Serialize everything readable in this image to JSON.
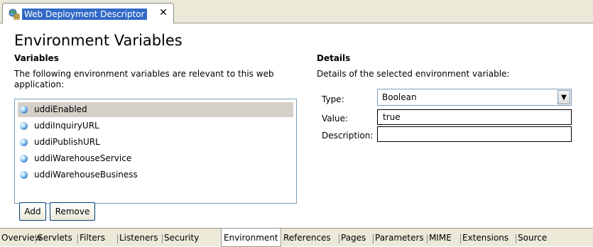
{
  "editor_tab": {
    "title": "Web Deployment Descriptor",
    "close_glyph": "✕",
    "icon": "web-app-icon"
  },
  "page": {
    "title": "Environment Variables"
  },
  "variables": {
    "title": "Variables",
    "description": "The following environment variables are relevant to this web application:",
    "items": [
      {
        "label": "uddiEnabled",
        "selected": true
      },
      {
        "label": "uddiInquiryURL",
        "selected": false
      },
      {
        "label": "uddiPublishURL",
        "selected": false
      },
      {
        "label": "uddiWarehouseService",
        "selected": false
      },
      {
        "label": "uddiWarehouseBusiness",
        "selected": false
      }
    ],
    "add_label": "Add",
    "remove_label": "Remove"
  },
  "details": {
    "title": "Details",
    "description": "Details of the selected environment variable:",
    "type_label": "Type:",
    "type_value": "Boolean",
    "value_label": "Value:",
    "value_value": "true",
    "description_label": "Description:",
    "description_value": ""
  },
  "page_tabs": [
    {
      "label": "Overview",
      "active": false
    },
    {
      "label": "Servlets",
      "active": false
    },
    {
      "label": "Filters",
      "active": false
    },
    {
      "label": "Listeners",
      "active": false
    },
    {
      "label": "Security",
      "active": false
    },
    {
      "label": "Environment",
      "active": true
    },
    {
      "label": "References",
      "active": false
    },
    {
      "label": "Pages",
      "active": false
    },
    {
      "label": "Parameters",
      "active": false
    },
    {
      "label": "MIME",
      "active": false
    },
    {
      "label": "Extensions",
      "active": false
    },
    {
      "label": "Source",
      "active": false
    }
  ],
  "colors": {
    "selection": "#3169c6",
    "frame": "#ece9d8"
  }
}
